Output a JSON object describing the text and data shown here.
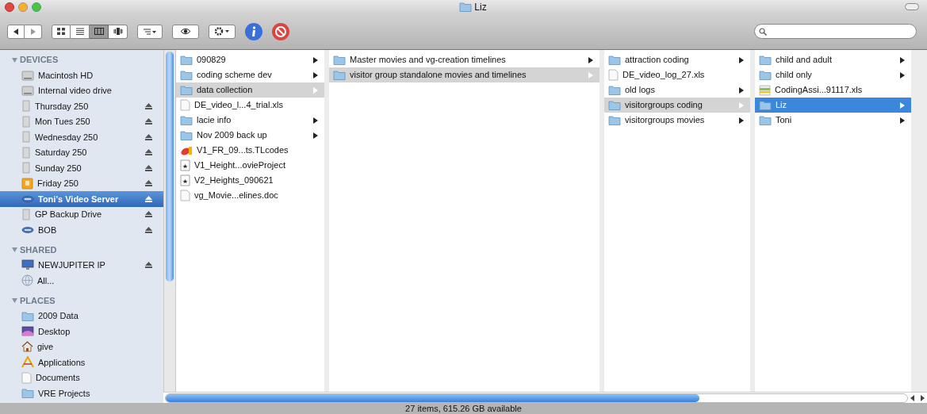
{
  "window": {
    "title": "Liz"
  },
  "sidebar": {
    "sections": [
      {
        "title": "DEVICES",
        "expanded": true,
        "items": [
          {
            "label": "Macintosh HD",
            "kind": "disk",
            "eject": false,
            "selected": false
          },
          {
            "label": "Internal video drive",
            "kind": "disk",
            "eject": false,
            "selected": false
          },
          {
            "label": "Thursday 250",
            "kind": "volume",
            "eject": true,
            "selected": false
          },
          {
            "label": "Mon Tues 250",
            "kind": "volume",
            "eject": true,
            "selected": false
          },
          {
            "label": "Wednesday 250",
            "kind": "volume",
            "eject": true,
            "selected": false
          },
          {
            "label": "Saturday 250",
            "kind": "volume",
            "eject": true,
            "selected": false
          },
          {
            "label": "Sunday 250",
            "kind": "volume",
            "eject": true,
            "selected": false
          },
          {
            "label": "Friday 250",
            "kind": "external",
            "eject": true,
            "selected": false
          },
          {
            "label": "Toni's Video Server",
            "kind": "server",
            "eject": true,
            "selected": true
          },
          {
            "label": "GP Backup Drive",
            "kind": "volume",
            "eject": true,
            "selected": false
          },
          {
            "label": "BOB",
            "kind": "server",
            "eject": true,
            "selected": false
          }
        ]
      },
      {
        "title": "SHARED",
        "expanded": true,
        "items": [
          {
            "label": "NEWJUPITER IP",
            "kind": "computer",
            "eject": true,
            "selected": false
          },
          {
            "label": "All...",
            "kind": "globe",
            "eject": false,
            "selected": false
          }
        ]
      },
      {
        "title": "PLACES",
        "expanded": true,
        "items": [
          {
            "label": "2009 Data",
            "kind": "folder",
            "eject": false,
            "selected": false
          },
          {
            "label": "Desktop",
            "kind": "desktop",
            "eject": false,
            "selected": false
          },
          {
            "label": "give",
            "kind": "home",
            "eject": false,
            "selected": false
          },
          {
            "label": "Applications",
            "kind": "apps",
            "eject": false,
            "selected": false
          },
          {
            "label": "Documents",
            "kind": "document",
            "eject": false,
            "selected": false
          },
          {
            "label": "VRE Projects",
            "kind": "folder",
            "eject": false,
            "selected": false
          }
        ]
      }
    ]
  },
  "columns": [
    {
      "focused": false,
      "items": [
        {
          "label": "090829",
          "kind": "folder",
          "selected": false
        },
        {
          "label": "coding scheme dev",
          "kind": "folder",
          "selected": false
        },
        {
          "label": "data collection",
          "kind": "folder",
          "selected": true
        },
        {
          "label": "DE_video_l...4_trial.xls",
          "kind": "document",
          "selected": false
        },
        {
          "label": "lacie info",
          "kind": "folder",
          "selected": false
        },
        {
          "label": "Nov 2009 back up",
          "kind": "folder",
          "selected": false
        },
        {
          "label": "V1_FR_09...ts.TLcodes",
          "kind": "codes",
          "selected": false
        },
        {
          "label": "V1_Height...ovieProject",
          "kind": "project",
          "selected": false
        },
        {
          "label": "V2_Heights_090621",
          "kind": "project",
          "selected": false
        },
        {
          "label": "vg_Movie...elines.doc",
          "kind": "document",
          "selected": false
        }
      ]
    },
    {
      "focused": false,
      "items": [
        {
          "label": "Master movies and vg-creation timelines",
          "kind": "folder",
          "selected": false
        },
        {
          "label": "visitor group standalone movies and timelines",
          "kind": "folder",
          "selected": true
        }
      ]
    },
    {
      "focused": false,
      "items": [
        {
          "label": "attraction coding",
          "kind": "folder",
          "selected": false
        },
        {
          "label": "DE_video_log_27.xls",
          "kind": "document",
          "selected": false
        },
        {
          "label": "old logs",
          "kind": "folder",
          "selected": false
        },
        {
          "label": "visitorgroups coding",
          "kind": "folder",
          "selected": true
        },
        {
          "label": "visitorgroups movies",
          "kind": "folder",
          "selected": false
        }
      ]
    },
    {
      "focused": true,
      "items": [
        {
          "label": "child and adult",
          "kind": "folder",
          "selected": false
        },
        {
          "label": "child only",
          "kind": "folder",
          "selected": false
        },
        {
          "label": "CodingAssi...91117.xls",
          "kind": "sheet",
          "selected": false
        },
        {
          "label": "Liz",
          "kind": "folder",
          "selected": true
        },
        {
          "label": "Toni",
          "kind": "folder",
          "selected": false
        }
      ]
    }
  ],
  "status_bar": "27 items, 615.26 GB available"
}
